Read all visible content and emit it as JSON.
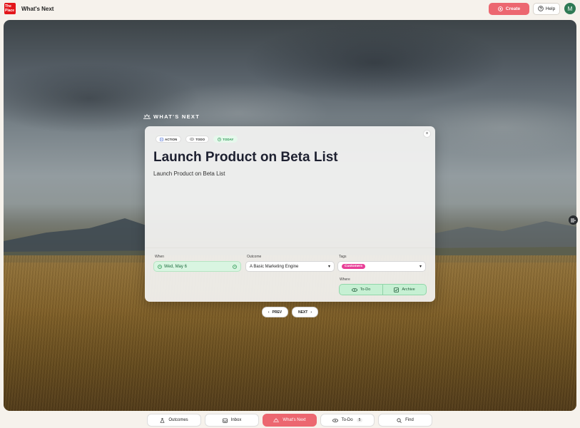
{
  "app": {
    "logo_text": "The Place",
    "title": "What's Next"
  },
  "header": {
    "create_label": "Create",
    "help_label": "Help",
    "avatar_initial": "M",
    "accent": "#ec6770"
  },
  "section_heading": "WHAT'S NEXT",
  "card": {
    "badges": [
      "ACTION",
      "TODO",
      "TODAY"
    ],
    "title": "Launch Product on Beta List",
    "subtitle": "Launch Product on Beta List",
    "when": {
      "label": "When",
      "value": "Wed, May 6"
    },
    "outcome": {
      "label": "Outcome",
      "value": "A Basic Marketing Engine"
    },
    "tags": {
      "label": "Tags",
      "chip": "Customers",
      "chip_color": "#e83f97"
    },
    "where": {
      "label": "Where",
      "options": [
        "To-Do",
        "Archive"
      ]
    }
  },
  "pager": {
    "prev": "PREV",
    "next": "NEXT"
  },
  "bottom_nav": [
    {
      "label": "Outcomes",
      "icon": "flask-icon"
    },
    {
      "label": "Inbox",
      "icon": "inbox-icon"
    },
    {
      "label": "What's Next",
      "icon": "sunrise-icon",
      "active": true
    },
    {
      "label": "To-Do",
      "icon": "eye-icon",
      "count": "5"
    },
    {
      "label": "Find",
      "icon": "search-icon"
    }
  ]
}
